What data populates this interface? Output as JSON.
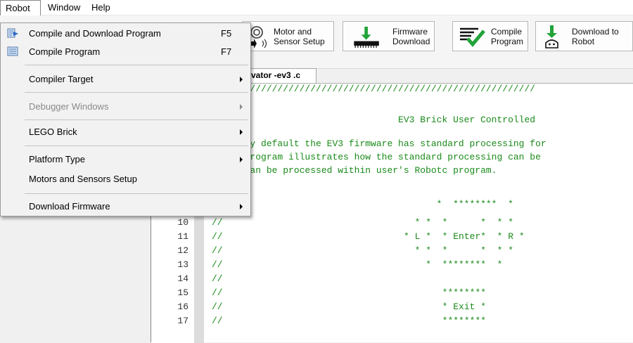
{
  "menubar": {
    "items": [
      "Robot",
      "Window",
      "Help"
    ]
  },
  "toolbar": {
    "motor_sensor": "Motor and\nSensor Setup",
    "firmware_download": "Firmware\nDownload",
    "compile_program": "Compile\nProgram",
    "download_to_robot": "Download to\nRobot"
  },
  "editor": {
    "tab_title": "levator -ev3 .c",
    "lines": [
      {
        "ln": "",
        "text": "                  ////////////////////////////////////////////////////"
      },
      {
        "ln": "",
        "text": ""
      },
      {
        "ln": "",
        "text": "                                             EV3 Brick User Controlled"
      },
      {
        "ln": "",
        "text": ""
      },
      {
        "ln": "",
        "text": "                  y default the EV3 firmware has standard processing for"
      },
      {
        "ln": "",
        "text": "                  rogram illustrates how the standard processing can be"
      },
      {
        "ln": "",
        "text": "                  an be processed within user's Robotc program."
      },
      {
        "ln": "",
        "text": ""
      },
      {
        "ln": "",
        "text": "                                                    *  ********  *"
      },
      {
        "ln": "10",
        "text": "//                                   * *  *      *  * *"
      },
      {
        "ln": "11",
        "text": "//                                 * L *  * Enter*  * R *"
      },
      {
        "ln": "12",
        "text": "//                                   * *  *      *  * *"
      },
      {
        "ln": "13",
        "text": "//                                     *  ********  *"
      },
      {
        "ln": "14",
        "text": "//"
      },
      {
        "ln": "15",
        "text": "//                                        ********"
      },
      {
        "ln": "16",
        "text": "//                                        * Exit *"
      },
      {
        "ln": "17",
        "text": "//                                        ********"
      }
    ]
  },
  "robot_menu": {
    "items": [
      {
        "label": "Compile and Download Program",
        "shortcut": "F5",
        "submenu": false,
        "disabled": false,
        "icon": "compile-download-icon"
      },
      {
        "label": "Compile Program",
        "shortcut": "F7",
        "submenu": false,
        "disabled": false,
        "icon": "compile-icon"
      },
      {
        "label": "Compiler Target",
        "shortcut": "",
        "submenu": true,
        "disabled": false
      },
      {
        "label": "Debugger Windows",
        "shortcut": "",
        "submenu": true,
        "disabled": true
      },
      {
        "label": "LEGO Brick",
        "shortcut": "",
        "submenu": true,
        "disabled": false
      },
      {
        "label": "Platform Type",
        "shortcut": "",
        "submenu": true,
        "disabled": false
      },
      {
        "label": "Motors and Sensors Setup",
        "shortcut": "",
        "submenu": false,
        "disabled": false
      },
      {
        "label": "Download Firmware",
        "shortcut": "",
        "submenu": true,
        "disabled": false
      }
    ]
  },
  "colors": {
    "code_comment": "#1a8a1a",
    "menu_bg": "#f2f2f2",
    "compile_check": "#22a33a"
  }
}
